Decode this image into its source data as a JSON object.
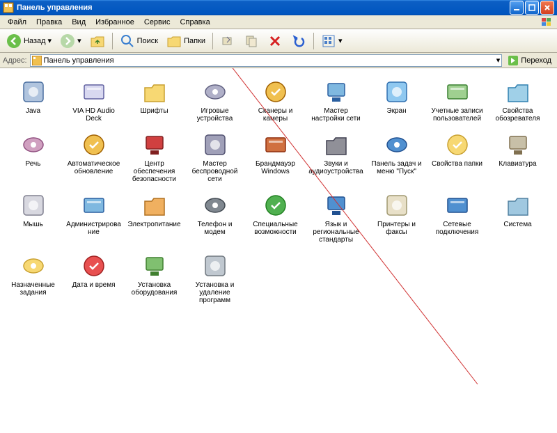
{
  "window": {
    "title": "Панель управления"
  },
  "menu": {
    "file": "Файл",
    "edit": "Правка",
    "view": "Вид",
    "favorites": "Избранное",
    "tools": "Сервис",
    "help": "Справка"
  },
  "toolbar": {
    "back": "Назад",
    "search": "Поиск",
    "folders": "Папки"
  },
  "addressbar": {
    "label": "Адрес:",
    "value": "Панель управления",
    "go": "Переход"
  },
  "items": [
    {
      "label": "Java"
    },
    {
      "label": "VIA HD Audio Deck"
    },
    {
      "label": "Шрифты"
    },
    {
      "label": "Игровые устройства"
    },
    {
      "label": "Сканеры и камеры"
    },
    {
      "label": "Мастер настройки сети"
    },
    {
      "label": "Экран"
    },
    {
      "label": "Учетные записи пользователей"
    },
    {
      "label": "Свойства обозревателя"
    },
    {
      "label": "Речь"
    },
    {
      "label": "Автоматическое обновление"
    },
    {
      "label": "Центр обеспечения безопасности"
    },
    {
      "label": "Мастер беспроводной сети"
    },
    {
      "label": "Брандмауэр Windows"
    },
    {
      "label": "Звуки и аудиоустройства"
    },
    {
      "label": "Панель задач и меню \"Пуск\""
    },
    {
      "label": "Свойства папки"
    },
    {
      "label": "Клавиатура"
    },
    {
      "label": "Мышь"
    },
    {
      "label": "Администрирование"
    },
    {
      "label": "Электропитание"
    },
    {
      "label": "Телефон и модем"
    },
    {
      "label": "Специальные возможности"
    },
    {
      "label": "Язык и региональные стандарты"
    },
    {
      "label": "Принтеры и факсы"
    },
    {
      "label": "Сетевые подключения"
    },
    {
      "label": "Система"
    },
    {
      "label": "Назначенные задания"
    },
    {
      "label": "Дата и время"
    },
    {
      "label": "Установка оборудования"
    },
    {
      "label": "Установка и удаление программ"
    }
  ]
}
